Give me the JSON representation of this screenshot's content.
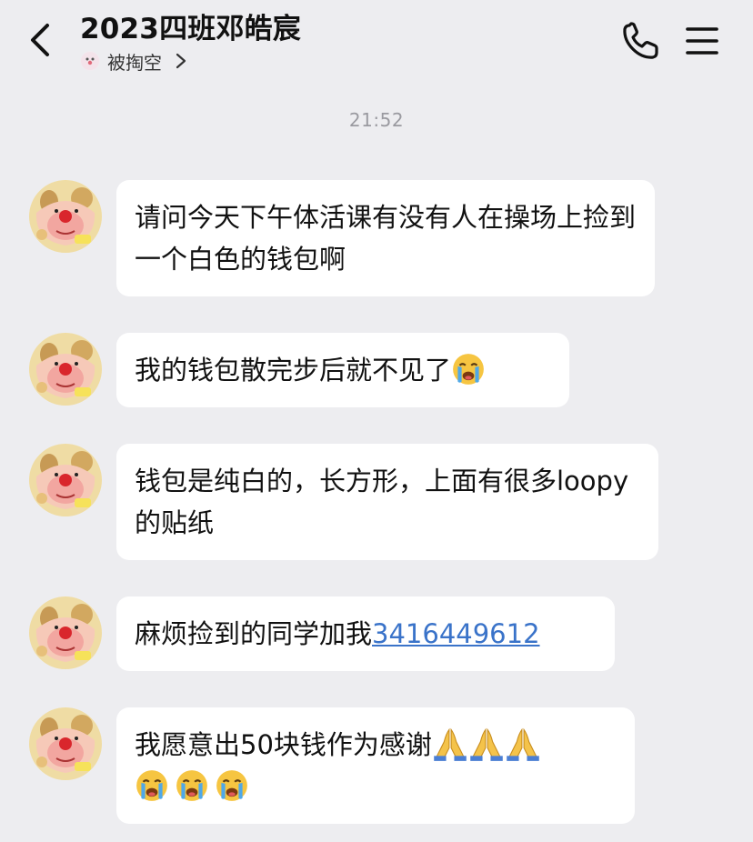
{
  "header": {
    "title": "2023四班邓皓宸",
    "subtitle": "被掏空"
  },
  "timestamp": "21:52",
  "messages": [
    {
      "text": "请问今天下午体活课有没有人在操场上捡到一个白色的钱包啊"
    },
    {
      "text": "我的钱包散完步后就不见了",
      "emoji_after": [
        "loudly-crying-face"
      ]
    },
    {
      "text": "钱包是纯白的，长方形，上面有很多loopy的贴纸"
    },
    {
      "text": "麻烦捡到的同学加我",
      "link": "3416449612"
    },
    {
      "text": "我愿意出50块钱作为感谢",
      "emoji_after": [
        "folded-hands",
        "folded-hands",
        "folded-hands",
        "loudly-crying-face",
        "loudly-crying-face",
        "loudly-crying-face"
      ]
    }
  ],
  "icons": {
    "back": "chevron-left-icon",
    "call": "phone-icon",
    "menu": "hamburger-menu-icon",
    "chevron": "chevron-right-icon"
  },
  "colors": {
    "background": "#ededf0",
    "bubble": "#ffffff",
    "link": "#3a73c9",
    "timestamp": "#9a9aa0"
  }
}
